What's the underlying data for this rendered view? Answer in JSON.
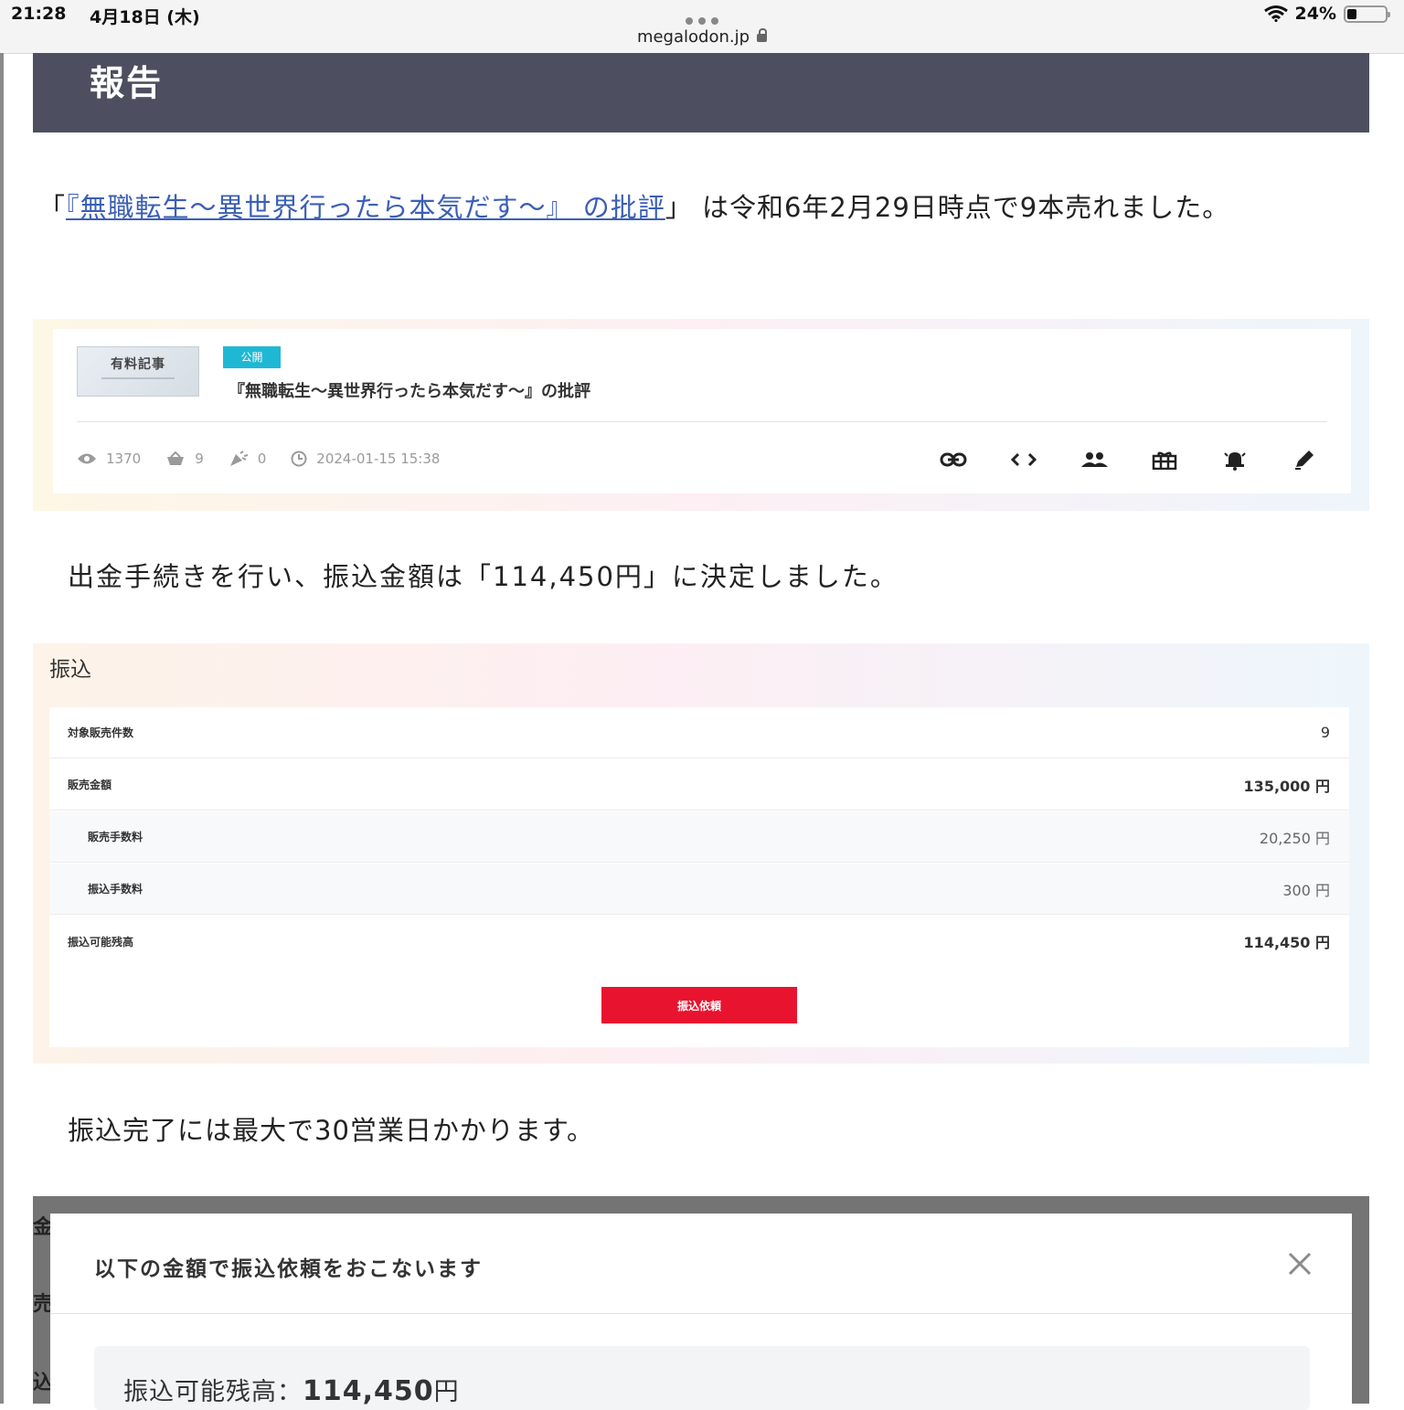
{
  "status_bar": {
    "time": "21:28",
    "date": "4月18日 (木)",
    "url": "megalodon.jp",
    "battery": "24%",
    "battery_level": 0.24
  },
  "heading": "報告",
  "intro": {
    "open_quote": "「",
    "link_text": "『無職転生～異世界行ったら本気だす～』 の批評",
    "rest": "」 は令和6年2月29日時点で9本売れました。"
  },
  "card": {
    "thumb_text": "有料記事",
    "badge": "公開",
    "title": "『無職転生～異世界行ったら本気だす～』の批評",
    "views": "1370",
    "sales": "9",
    "support": "0",
    "datetime": "2024-01-15 15:38",
    "action_icons": [
      "link-icon",
      "code-icon",
      "group-icon",
      "gift-icon",
      "bell-icon",
      "edit-icon"
    ]
  },
  "withdraw_text": "出金手続きを行い、振込金額は「114,450円」に決定しました。",
  "transfer": {
    "label": "振込",
    "rows": [
      {
        "key": "対象販売件数",
        "value": "9"
      },
      {
        "key": "販売金額",
        "value": "135,000 円"
      },
      {
        "key": "販売手数料",
        "value": "20,250 円"
      },
      {
        "key": "振込手数料",
        "value": "300 円"
      },
      {
        "key": "振込可能残高",
        "value": "114,450 円"
      }
    ],
    "button": "振込依頼"
  },
  "completion_text": "振込完了には最大で30営業日かかります。",
  "modal": {
    "peek": [
      "金",
      "売",
      "込"
    ],
    "title": "以下の金額で振込依頼をおこないます",
    "balance_label": "振込可能残高：",
    "balance_amount": "114,450",
    "balance_unit": "円"
  },
  "colors": {
    "heading_bg": "#4d4f60",
    "badge": "#1fb8d4",
    "button": "#e8142f",
    "link": "#3b5fb5"
  }
}
